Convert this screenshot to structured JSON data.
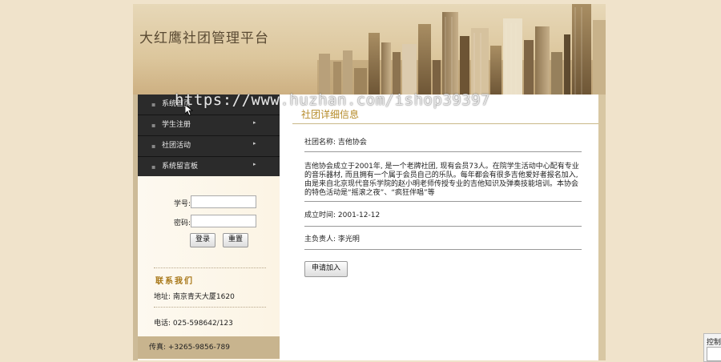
{
  "header": {
    "site_title": "大红鹰社团管理平台"
  },
  "nav": {
    "items": [
      {
        "label": "系统首页",
        "has_arrow": false
      },
      {
        "label": "学生注册",
        "has_arrow": true
      },
      {
        "label": "社团活动",
        "has_arrow": true
      },
      {
        "label": "系统留言板",
        "has_arrow": true
      }
    ]
  },
  "login": {
    "student_id_label": "学号:",
    "password_label": "密码:",
    "student_id_value": "",
    "password_value": "",
    "login_button": "登录",
    "reset_button": "重置"
  },
  "contact": {
    "heading": "联系我们",
    "address": "地址: 南京青天大厦1620",
    "phone": "电话: 025-598642/123",
    "fax": "传真: +3265-9856-789"
  },
  "detail": {
    "title": "社团详细信息",
    "name": "社团名称: 吉他协会",
    "description": "吉他协会成立于2001年, 是一个老牌社团, 现有会员73人。在院学生活动中心配有专业的音乐器材, 而且拥有一个属于会员自己的乐队。每年都会有很多吉他爱好者报名加入, 由是来自北京现代音乐学院的赵小明老师传授专业的吉他知识及弹奏技能培训。本协会的特色活动是“摇滚之夜”、“疯狂伴唱”等",
    "founded": "成立时间: 2001-12-12",
    "leader": "主负责人: 李光明",
    "apply_button": "申请加入"
  },
  "side_panel": {
    "label": "控制"
  },
  "watermark": "https://www.huzhan.com/ishop39397",
  "colors": {
    "accent": "#b58a28",
    "menu_bg": "#2b2b2b",
    "page_bg": "#f0e3cb"
  }
}
